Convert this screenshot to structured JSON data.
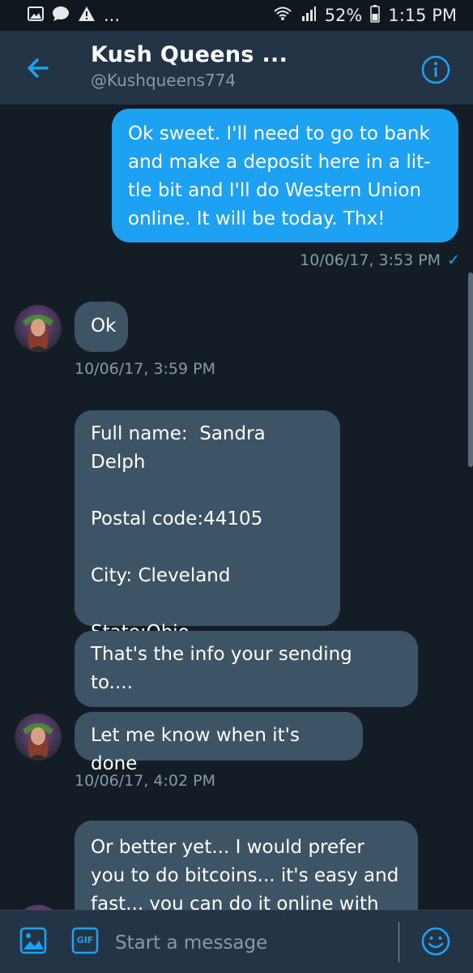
{
  "status_bar": {
    "left_dots": "...",
    "battery": "52%",
    "time": "1:15 PM"
  },
  "header": {
    "title": "Kush Queens ...",
    "handle": "@Kushqueens774"
  },
  "messages": [
    {
      "direction": "outgoing",
      "text": "Ok sweet. I'll need to go to bank\nand make a deposit here in a lit-\ntle bit and I'll do Western Union\nonline. It will be today. Thx!"
    },
    {
      "direction": "incoming",
      "text": "Ok"
    },
    {
      "direction": "incoming",
      "text": "Full name:  Sandra Delph\n\nPostal code:44105\n\nCity: Cleveland\n\nState:Ohio"
    },
    {
      "direction": "incoming",
      "text": "That's the info your sending\nto...."
    },
    {
      "direction": "incoming",
      "text": "Let me know when it's done"
    },
    {
      "direction": "incoming",
      "text": "Or better yet... I would prefer\nyou to do bitcoins... it's easy and\nfast... you can do it online with"
    }
  ],
  "timestamps": {
    "t1": "10/06/17, 3:53 PM",
    "t2": "10/06/17, 3:59 PM",
    "t3": "10/06/17, 4:02 PM"
  },
  "composer": {
    "placeholder": "Start a message",
    "gif_label": "GIF"
  },
  "colors": {
    "background": "#141d26",
    "header": "#243447",
    "outgoing_bubble": "#1da1f2",
    "incoming_bubble": "#3d5466",
    "accent": "#1da1f2",
    "muted_text": "#8899a6"
  },
  "icons": [
    "image-icon",
    "message-icon",
    "warning-icon",
    "wifi-icon",
    "signal-icon",
    "battery-icon",
    "back-arrow-icon",
    "info-icon",
    "gallery-icon",
    "gif-icon",
    "emoji-icon"
  ]
}
